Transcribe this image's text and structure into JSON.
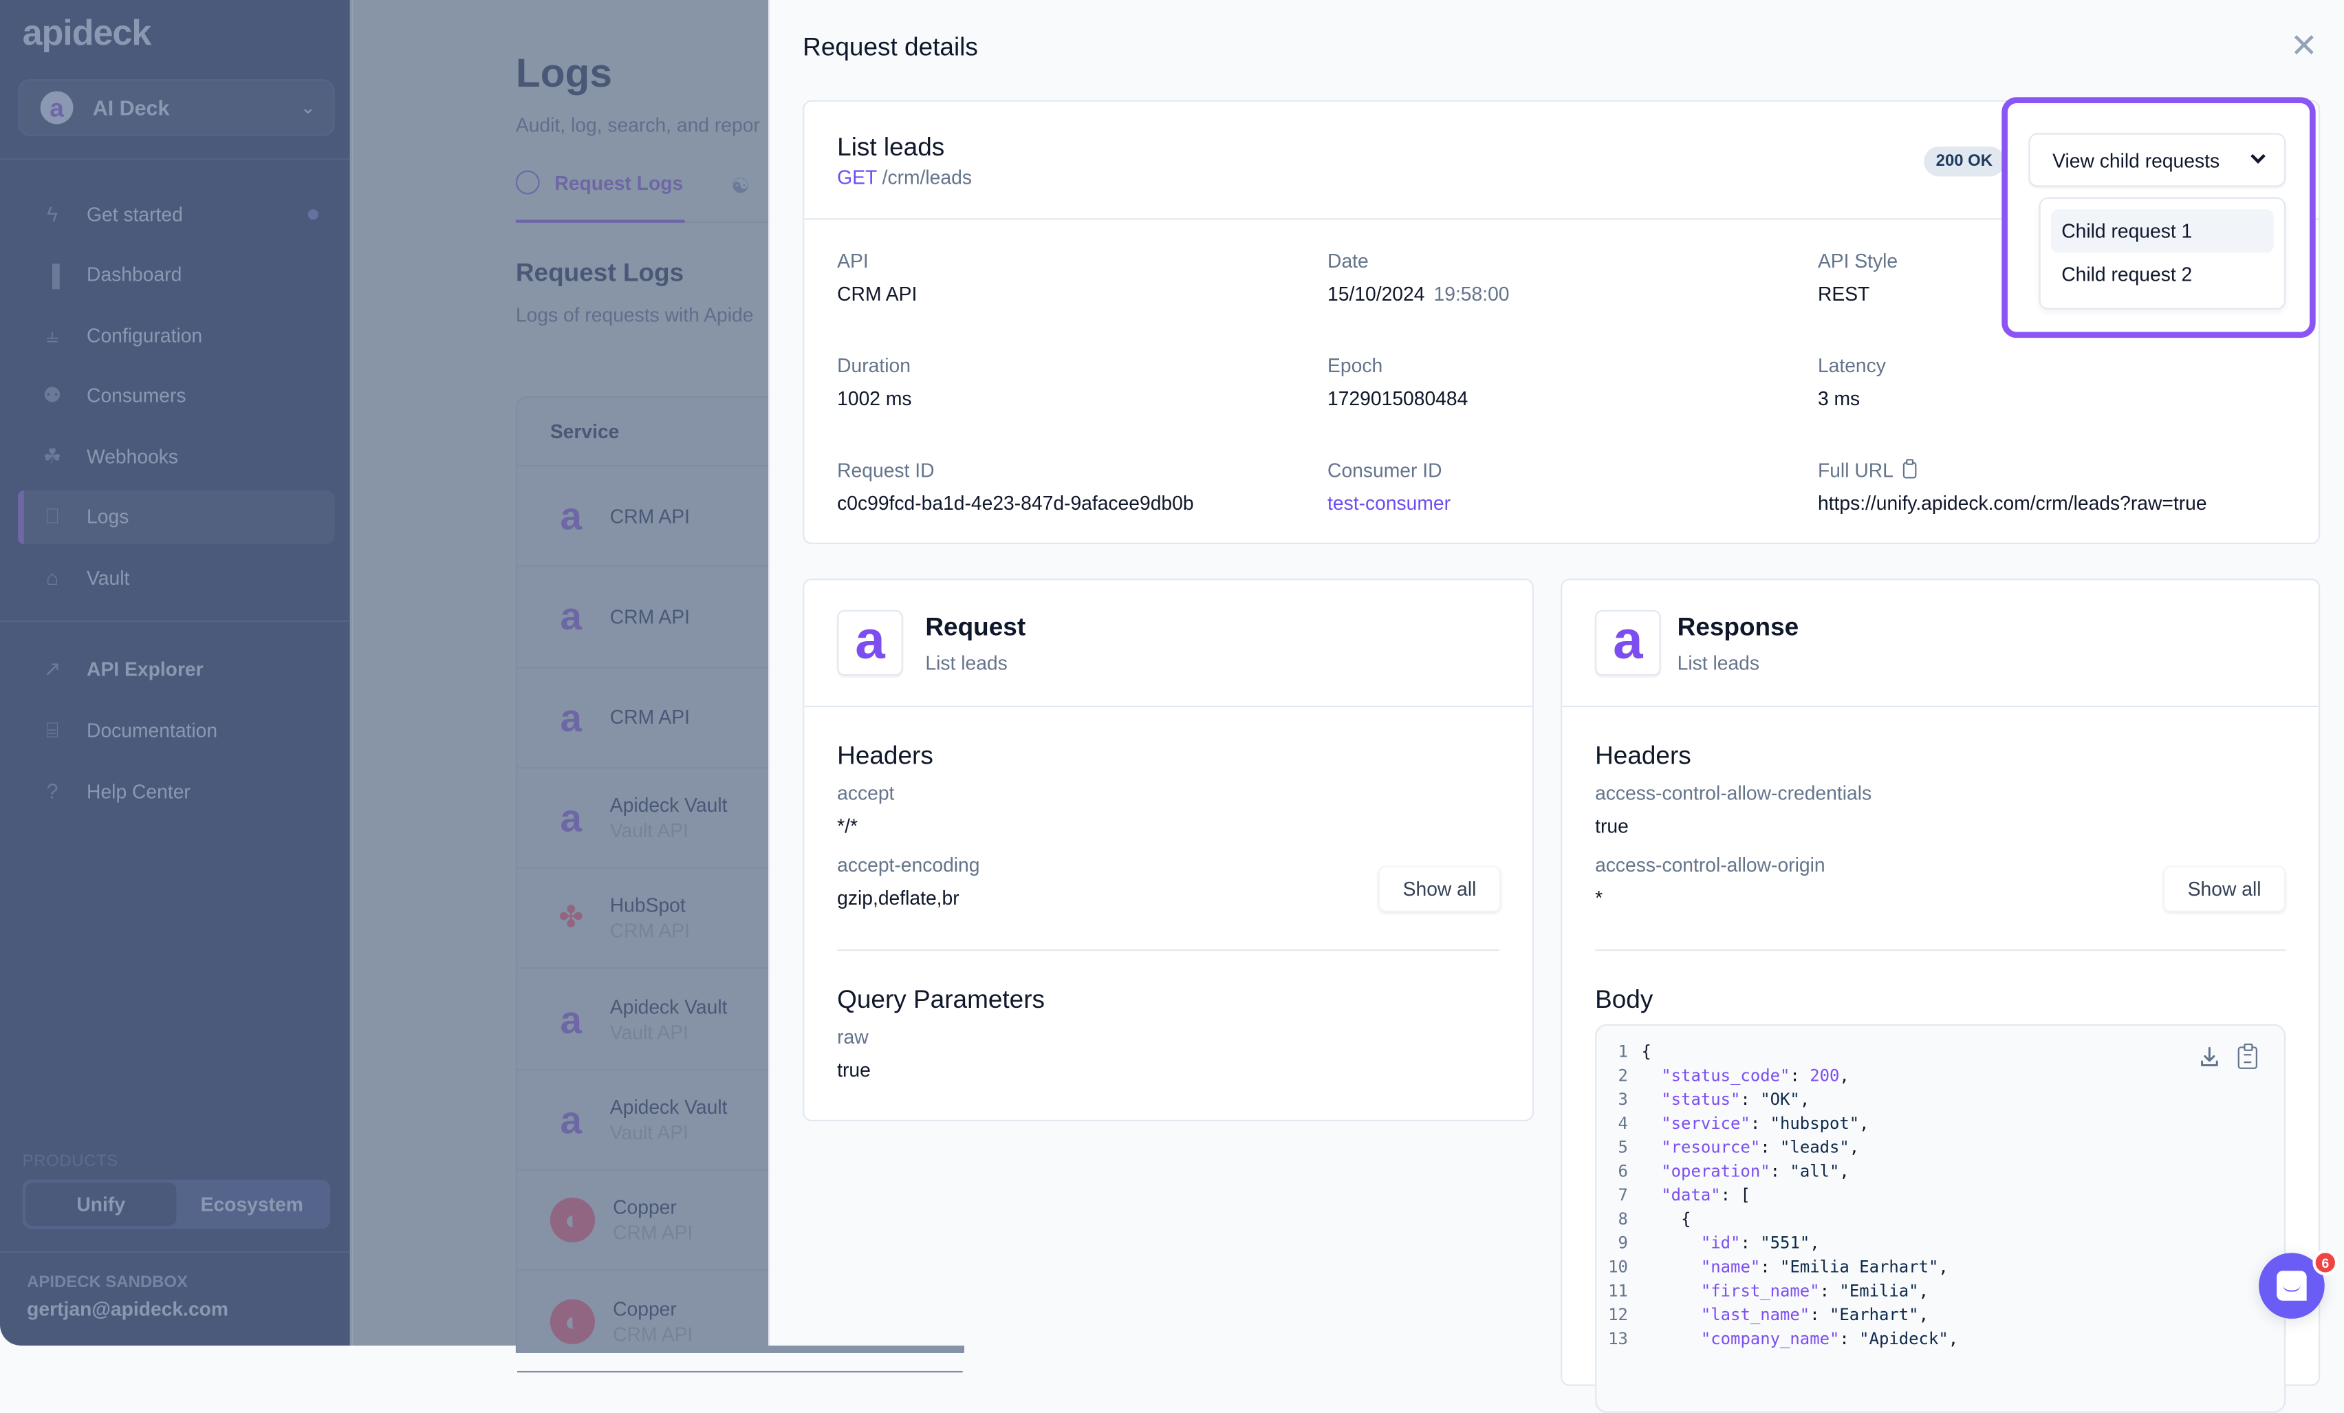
{
  "sidebar": {
    "logo": "apideck",
    "workspace": {
      "avatar_letter": "a",
      "name": "AI Deck"
    },
    "nav": [
      {
        "label": "Get started",
        "icon": "bolt-icon",
        "has_dot": true
      },
      {
        "label": "Dashboard",
        "icon": "bar-chart-icon"
      },
      {
        "label": "Configuration",
        "icon": "sliders-icon"
      },
      {
        "label": "Consumers",
        "icon": "users-icon"
      },
      {
        "label": "Webhooks",
        "icon": "webhook-icon"
      },
      {
        "label": "Logs",
        "icon": "log-search-icon",
        "active": true
      },
      {
        "label": "Vault",
        "icon": "lock-icon"
      }
    ],
    "secondary_nav": [
      {
        "label": "API Explorer",
        "icon": "telescope-icon"
      },
      {
        "label": "Documentation",
        "icon": "book-icon"
      },
      {
        "label": "Help Center",
        "icon": "help-circle-icon"
      }
    ],
    "products_label": "PRODUCTS",
    "products": [
      {
        "label": "Unify",
        "active": true
      },
      {
        "label": "Ecosystem"
      }
    ],
    "account": {
      "label": "APIDECK SANDBOX",
      "email": "gertjan@apideck.com"
    }
  },
  "background_page": {
    "title": "Logs",
    "subtitle": "Audit, log, search, and repor",
    "tabs": [
      {
        "label": "Request Logs",
        "icon": "globe-icon",
        "active": true
      },
      {
        "label": "",
        "icon": "webhook-icon"
      }
    ],
    "section_title": "Request Logs",
    "section_subtitle": "Logs of requests with Apide",
    "table_header": "Service",
    "rows": [
      {
        "logo": "apideck",
        "name": "CRM API",
        "type": ""
      },
      {
        "logo": "apideck",
        "name": "CRM API",
        "type": ""
      },
      {
        "logo": "apideck",
        "name": "CRM API",
        "type": ""
      },
      {
        "logo": "apideck",
        "name": "Apideck Vault",
        "type": "Vault API"
      },
      {
        "logo": "hubspot",
        "name": "HubSpot",
        "type": "CRM API"
      },
      {
        "logo": "apideck",
        "name": "Apideck Vault",
        "type": "Vault API"
      },
      {
        "logo": "apideck",
        "name": "Apideck Vault",
        "type": "Vault API"
      },
      {
        "logo": "copper",
        "name": "Copper",
        "type": "CRM API"
      },
      {
        "logo": "copper",
        "name": "Copper",
        "type": "CRM API"
      }
    ]
  },
  "drawer": {
    "title": "Request details",
    "summary": {
      "name": "List leads",
      "method": "GET",
      "path": "/crm/leads",
      "status_badge": "200 OK",
      "child_requests": {
        "button_label": "View child requests",
        "items": [
          "Child request 1",
          "Child request 2"
        ],
        "highlighted_index": 0
      },
      "fields": [
        {
          "label": "API",
          "value": "CRM API"
        },
        {
          "label": "Date",
          "value": "15/10/2024",
          "time": "19:58:00"
        },
        {
          "label": "API Style",
          "value": "REST"
        },
        {
          "label": "Duration",
          "value": "1002 ms"
        },
        {
          "label": "Epoch",
          "value": "1729015080484"
        },
        {
          "label": "Latency",
          "value": "3 ms"
        },
        {
          "label": "Request ID",
          "value": "c0c99fcd-ba1d-4e23-847d-9afacee9db0b"
        },
        {
          "label": "Consumer ID",
          "value": "test-consumer",
          "link": true
        },
        {
          "label": "Full URL",
          "value": "https://unify.apideck.com/crm/leads?raw=true",
          "copy": true
        }
      ]
    },
    "request": {
      "title": "Request",
      "subtitle": "List leads",
      "headers_title": "Headers",
      "headers": [
        {
          "key": "accept",
          "value": "*/*"
        },
        {
          "key": "accept-encoding",
          "value": "gzip,deflate,br"
        }
      ],
      "show_all": "Show all",
      "query_title": "Query Parameters",
      "query": [
        {
          "key": "raw",
          "value": "true"
        }
      ]
    },
    "response": {
      "title": "Response",
      "subtitle": "List leads",
      "headers_title": "Headers",
      "headers": [
        {
          "key": "access-control-allow-credentials",
          "value": "true"
        },
        {
          "key": "access-control-allow-origin",
          "value": "*"
        }
      ],
      "show_all": "Show all",
      "body_title": "Body",
      "body_lines": [
        {
          "n": "1",
          "indent": 0,
          "parts": [
            [
              "p",
              "{"
            ]
          ]
        },
        {
          "n": "2",
          "indent": 1,
          "parts": [
            [
              "k",
              "\"status_code\""
            ],
            [
              "p",
              ": "
            ],
            [
              "n",
              "200"
            ],
            [
              "p",
              ","
            ]
          ]
        },
        {
          "n": "3",
          "indent": 1,
          "parts": [
            [
              "k",
              "\"status\""
            ],
            [
              "p",
              ": "
            ],
            [
              "s",
              "\"OK\""
            ],
            [
              "p",
              ","
            ]
          ]
        },
        {
          "n": "4",
          "indent": 1,
          "parts": [
            [
              "k",
              "\"service\""
            ],
            [
              "p",
              ": "
            ],
            [
              "s",
              "\"hubspot\""
            ],
            [
              "p",
              ","
            ]
          ]
        },
        {
          "n": "5",
          "indent": 1,
          "parts": [
            [
              "k",
              "\"resource\""
            ],
            [
              "p",
              ": "
            ],
            [
              "s",
              "\"leads\""
            ],
            [
              "p",
              ","
            ]
          ]
        },
        {
          "n": "6",
          "indent": 1,
          "parts": [
            [
              "k",
              "\"operation\""
            ],
            [
              "p",
              ": "
            ],
            [
              "s",
              "\"all\""
            ],
            [
              "p",
              ","
            ]
          ]
        },
        {
          "n": "7",
          "indent": 1,
          "parts": [
            [
              "k",
              "\"data\""
            ],
            [
              "p",
              ": ["
            ]
          ]
        },
        {
          "n": "8",
          "indent": 2,
          "parts": [
            [
              "p",
              "{"
            ]
          ]
        },
        {
          "n": "9",
          "indent": 3,
          "parts": [
            [
              "k",
              "\"id\""
            ],
            [
              "p",
              ": "
            ],
            [
              "s",
              "\"551\""
            ],
            [
              "p",
              ","
            ]
          ]
        },
        {
          "n": "10",
          "indent": 3,
          "parts": [
            [
              "k",
              "\"name\""
            ],
            [
              "p",
              ": "
            ],
            [
              "s",
              "\"Emilia Earhart\""
            ],
            [
              "p",
              ","
            ]
          ]
        },
        {
          "n": "11",
          "indent": 3,
          "parts": [
            [
              "k",
              "\"first_name\""
            ],
            [
              "p",
              ": "
            ],
            [
              "s",
              "\"Emilia\""
            ],
            [
              "p",
              ","
            ]
          ]
        },
        {
          "n": "12",
          "indent": 3,
          "parts": [
            [
              "k",
              "\"last_name\""
            ],
            [
              "p",
              ": "
            ],
            [
              "s",
              "\"Earhart\""
            ],
            [
              "p",
              ","
            ]
          ]
        },
        {
          "n": "13",
          "indent": 3,
          "parts": [
            [
              "k",
              "\"company_name\""
            ],
            [
              "p",
              ": "
            ],
            [
              "s",
              "\"Apideck\""
            ],
            [
              "p",
              ","
            ]
          ]
        }
      ]
    }
  },
  "chat_widget": {
    "unread_count": "6"
  },
  "colors": {
    "accent": "#6d4df2",
    "highlight_border": "#8b55f6",
    "sidebar_bg": "#4b5a7b",
    "badge_red": "#ef4444"
  }
}
